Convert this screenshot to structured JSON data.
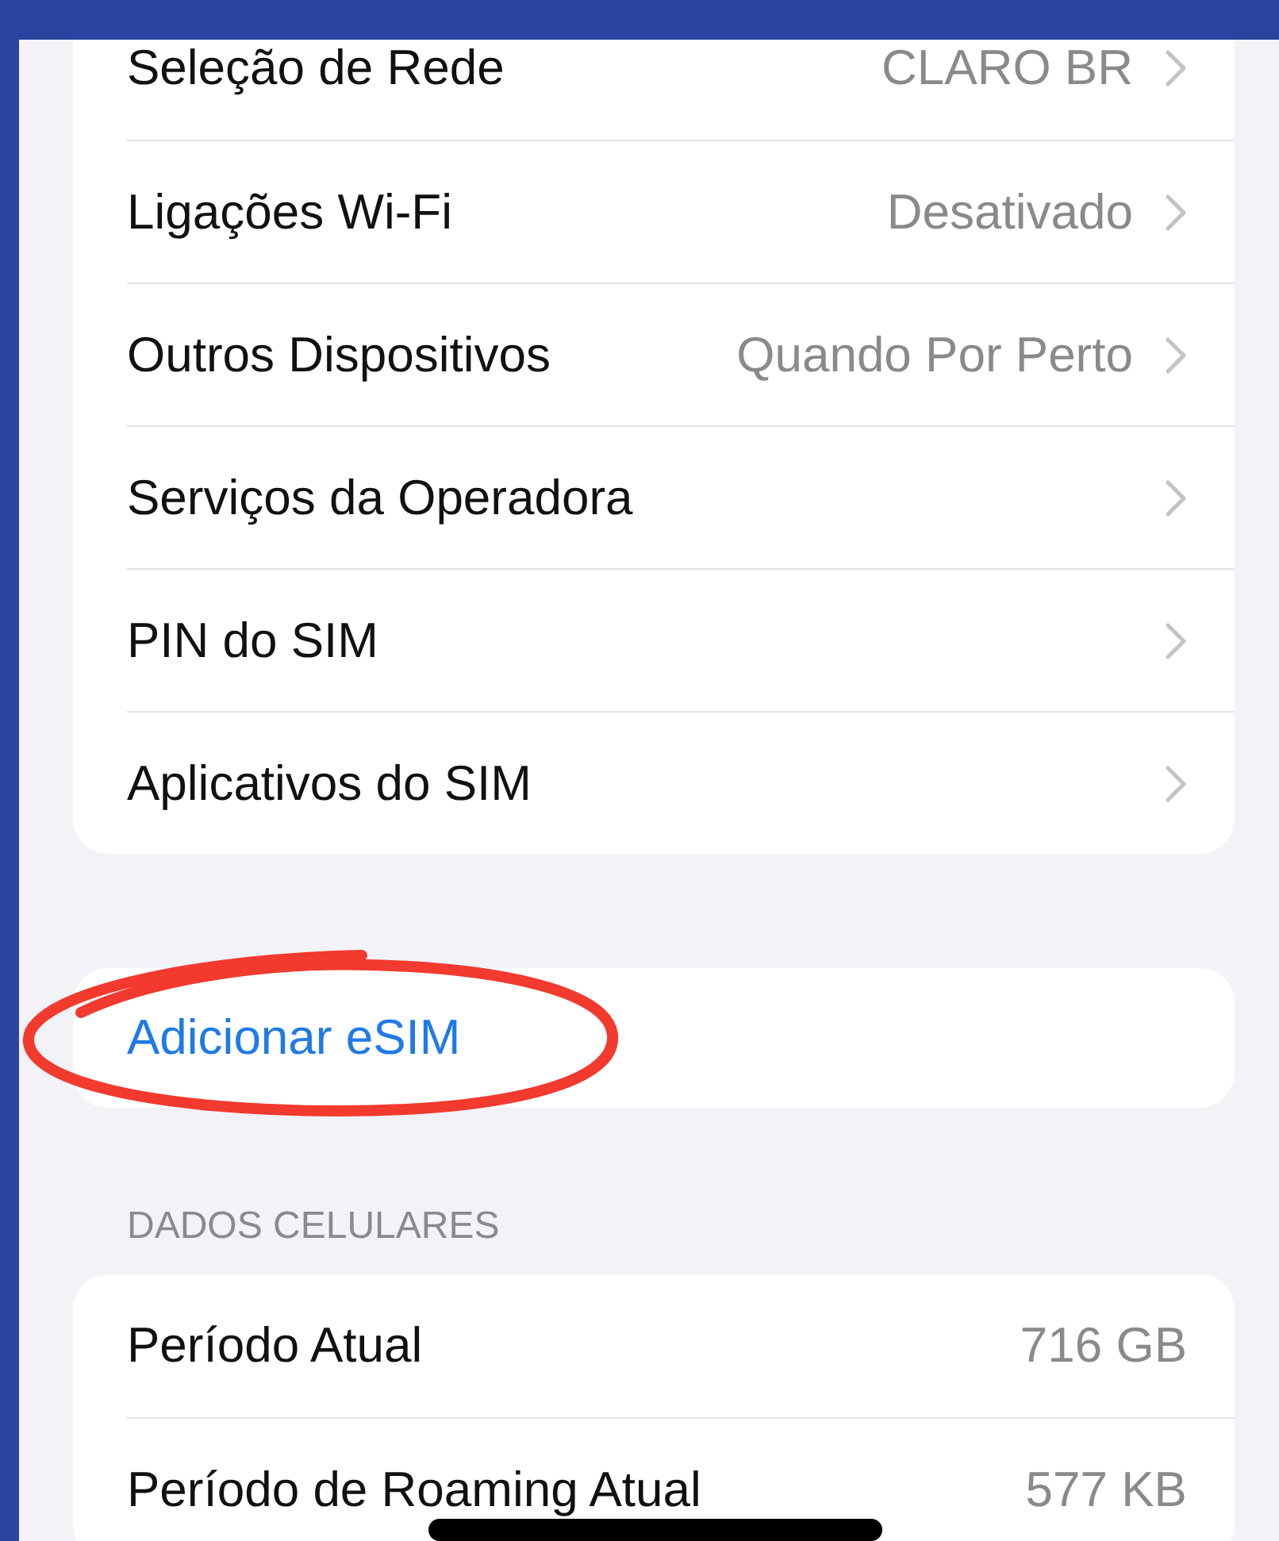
{
  "network_rows": [
    {
      "label": "Seleção de Rede",
      "value": "CLARO BR",
      "chevron": true
    },
    {
      "label": "Ligações Wi-Fi",
      "value": "Desativado",
      "chevron": true
    },
    {
      "label": "Outros Dispositivos",
      "value": "Quando Por Perto",
      "chevron": true
    },
    {
      "label": "Serviços da Operadora",
      "chevron": true
    },
    {
      "label": "PIN do SIM",
      "chevron": true
    },
    {
      "label": "Aplicativos do SIM",
      "chevron": true
    }
  ],
  "add_esim": {
    "label": "Adicionar eSIM",
    "highlighted": true
  },
  "cellular_data": {
    "header": "DADOS CELULARES",
    "rows": [
      {
        "label": "Período Atual",
        "value": "716 GB",
        "chevron": false
      },
      {
        "label": "Período de Roaming Atual",
        "value": "577 KB",
        "chevron": false
      }
    ]
  }
}
